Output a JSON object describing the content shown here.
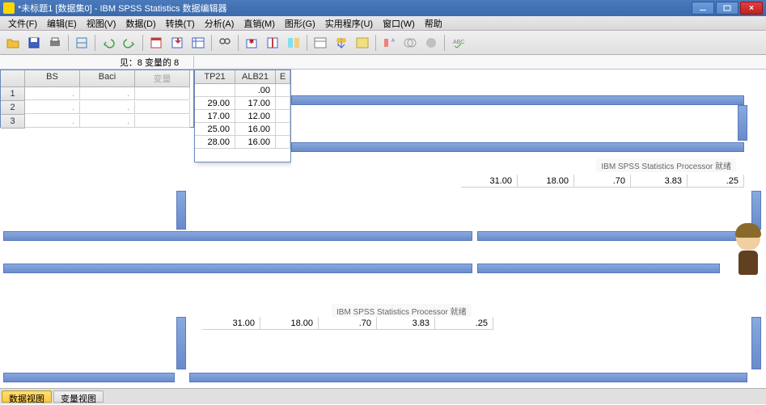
{
  "title": "*未标题1 [数据集0] - IBM SPSS Statistics 数据编辑器",
  "menu": [
    "文件(F)",
    "编辑(E)",
    "视图(V)",
    "数据(D)",
    "转换(T)",
    "分析(A)",
    "直销(M)",
    "图形(G)",
    "实用程序(U)",
    "窗口(W)",
    "帮助"
  ],
  "info_label": "见：8 变量的 8",
  "left_headers": [
    "BS",
    "Baci",
    "变量"
  ],
  "left_rows": [
    "1",
    "2",
    "3"
  ],
  "pop_headers": [
    "TP21",
    "ALB21",
    "E"
  ],
  "pop_data": [
    [
      "",
      ".00",
      ""
    ],
    [
      "29.00",
      "17.00",
      ""
    ],
    [
      "17.00",
      "12.00",
      ""
    ],
    [
      "25.00",
      "16.00",
      ""
    ],
    [
      "28.00",
      "16.00",
      ""
    ]
  ],
  "status_text": "IBM SPSS Statistics Processor 就绪",
  "mid_row": [
    "31.00",
    "18.00",
    ".70",
    "3.83",
    ".25"
  ],
  "footer_tabs": [
    "数据视图",
    "变量视图"
  ]
}
